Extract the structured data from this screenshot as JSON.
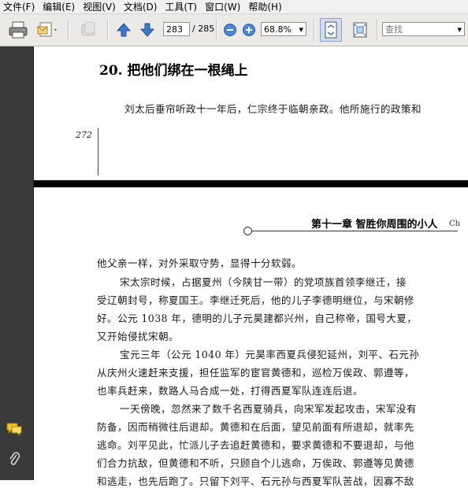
{
  "menu": [
    "文件(F)",
    "编辑(E)",
    "视图(V)",
    "文档(D)",
    "工具(T)",
    "窗口(W)",
    "帮助(H)"
  ],
  "toolbar": {
    "page_current": "283",
    "page_total": "/ 285",
    "zoom": "68.8%",
    "search_placeholder": "查找"
  },
  "page1": {
    "chapter_title": "20.  把他们绑在一根绳上",
    "line1": "刘太后垂帘听政十一年后，仁宗终于临朝亲政。他所施行的政策和",
    "page_number": "272"
  },
  "page2": {
    "header": "第十一章   智胜你周围的小人",
    "header_badge": "Ch",
    "lines": [
      "他父亲一样，对外采取守势，显得十分软弱。",
      "宋太宗时候，占据夏州（今陕甘一带）的党项族首领李继迁，接",
      "受辽朝封号，称夏国王。李继迁死后，他的儿子李德明继位，与宋朝修",
      "好。公元 1038 年，德明的儿子元昊建都兴州，自己称帝，国号大夏，",
      "又开始侵扰宋朝。",
      "宝元三年（公元 1040 年）元昊率西夏兵侵犯延州，刘平、石元孙",
      "从庆州火速赶来支援，担任监军的宦官黄德和，巡检万俟政、郭遵等，",
      "也率兵赶来，数路人马合成一处，打得西夏军队连连后退。",
      "一天傍晚，忽然来了数千名西夏骑兵，向宋军发起攻击，宋军没有",
      "防备，因而稍微往后退却。黄德和在后面，望见前面有所退却，就率先",
      "逃命。刘平见此，忙派儿子去追赶黄德和，要求黄德和不要退却，与他",
      "们合力抗敌，但黄德和不听，只顾自个儿逃命，万俟政、郭遵等见黄德",
      "和逃走，也先后跑了。只留下刘平、石元孙与西夏军队苦战，因寡不敌"
    ]
  }
}
